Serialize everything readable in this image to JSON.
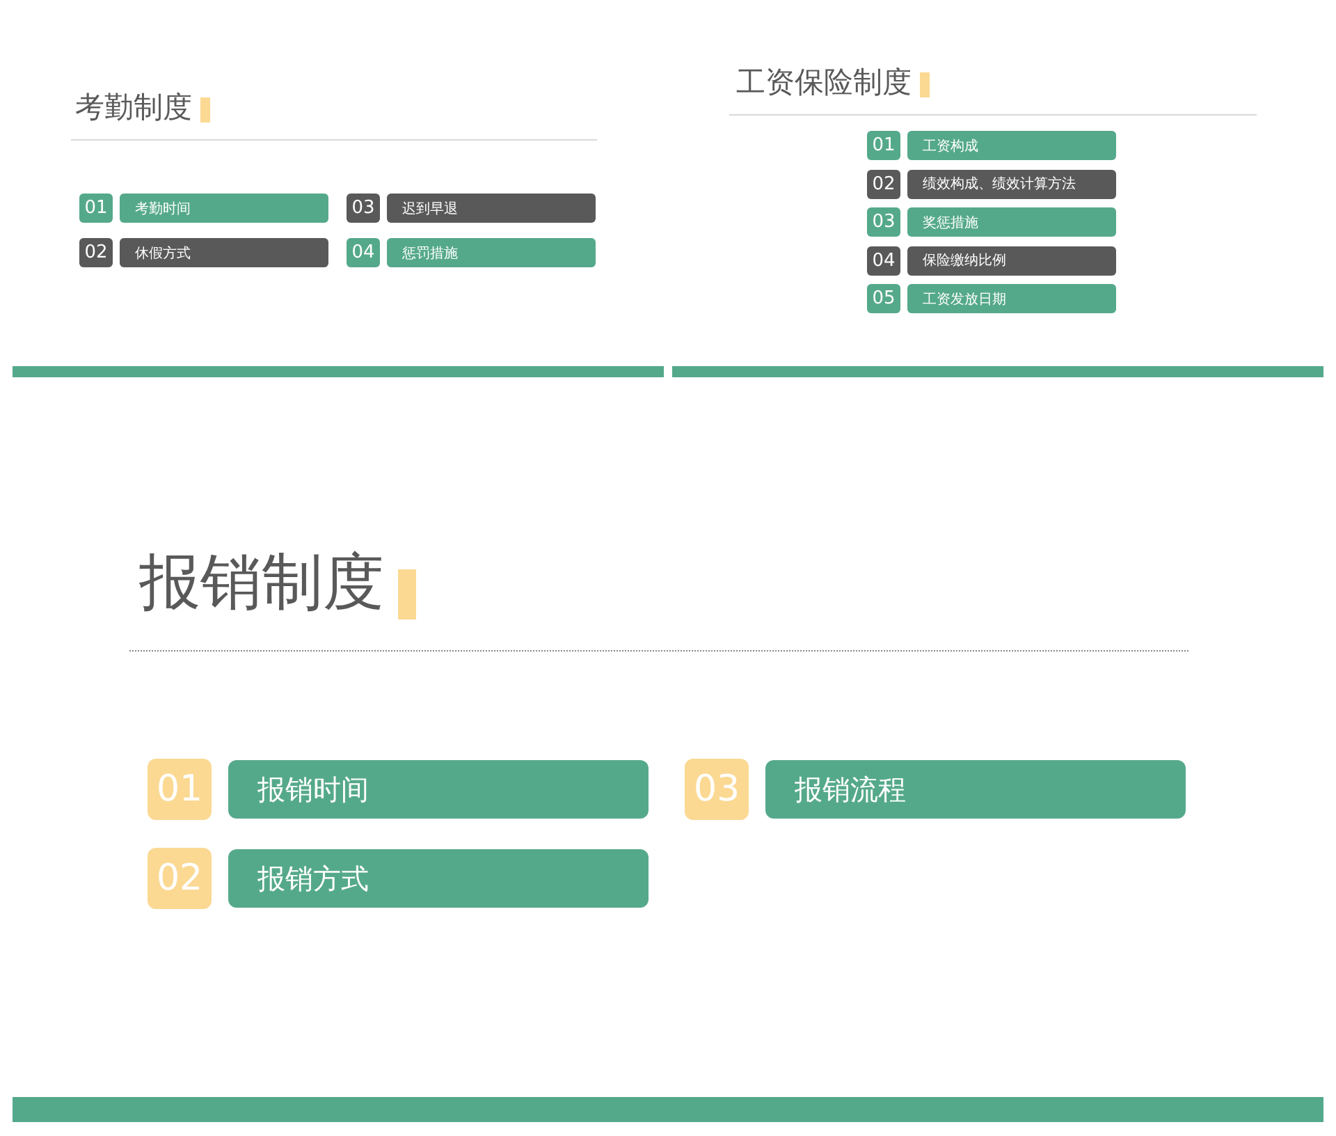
{
  "slides": [
    {
      "kind": "grid",
      "title": "考勤制度",
      "items": [
        {
          "number": "01",
          "label": "考勤时间",
          "color": "#55a98b"
        },
        {
          "number": "02",
          "label": "休假方式",
          "color": "#595959"
        },
        {
          "number": "03",
          "label": "迟到早退",
          "color": "#595959"
        },
        {
          "number": "04",
          "label": "惩罚措施",
          "color": "#55a98b"
        }
      ]
    },
    {
      "kind": "list",
      "title": "工资保险制度",
      "items": [
        {
          "number": "01",
          "label": "工资构成",
          "color": "#55a98b"
        },
        {
          "number": "02",
          "label": "绩效构成、绩效计算方法",
          "color": "#595959"
        },
        {
          "number": "03",
          "label": "奖惩措施",
          "color": "#55a98b"
        },
        {
          "number": "04",
          "label": "保险缴纳比例",
          "color": "#595959"
        },
        {
          "number": "05",
          "label": "工资发放日期",
          "color": "#55a98b"
        }
      ]
    },
    {
      "kind": "large",
      "title": "报销制度",
      "items": [
        {
          "number": "01",
          "label": "报销时间",
          "color": "#55a98b"
        },
        {
          "number": "02",
          "label": "报销方式",
          "color": "#55a98b"
        },
        {
          "number": "03",
          "label": "报销流程",
          "color": "#55a98b"
        }
      ]
    }
  ]
}
